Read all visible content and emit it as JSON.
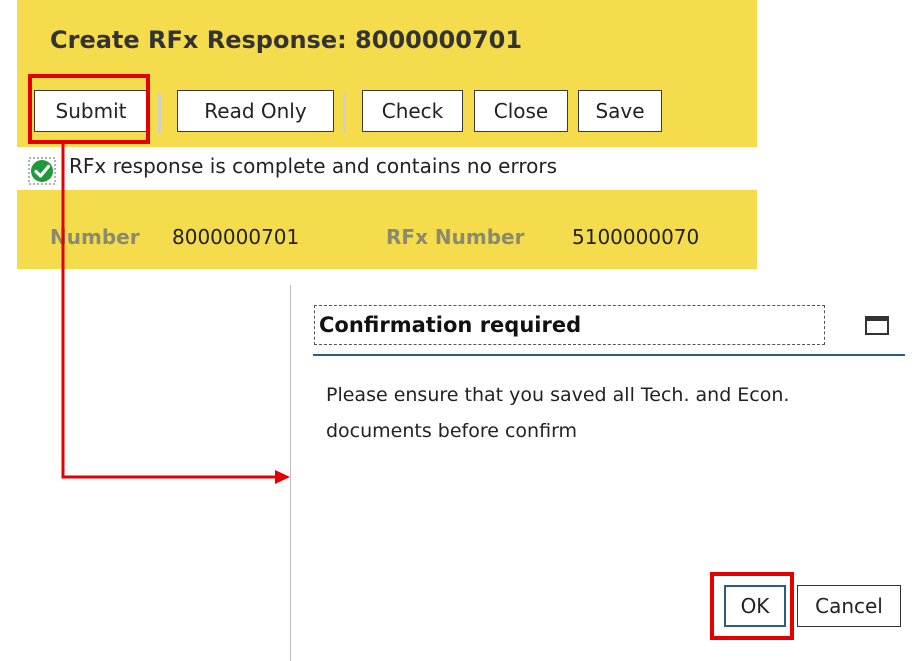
{
  "window": {
    "title": "Create RFx Response: 8000000701"
  },
  "toolbar": {
    "submit_label": "Submit",
    "read_only_label": "Read Only",
    "check_label": "Check",
    "close_label": "Close",
    "save_label": "Save"
  },
  "status": {
    "message": "RFx response  is complete and contains no errors",
    "icon": "check-circle-icon",
    "icon_color": "#1f9a3a"
  },
  "header_fields": {
    "number_label": "Number",
    "number_value": "8000000701",
    "rfx_number_label": "RFx Number",
    "rfx_number_value": "5100000070"
  },
  "dialog": {
    "title": "Confirmation required",
    "message": "Please ensure that you saved all Tech. and Econ. documents before confirm",
    "ok_label": "OK",
    "cancel_label": "Cancel"
  },
  "colors": {
    "band_yellow": "#f4dc4d",
    "highlight_red": "#e50000",
    "dialog_rule_blue": "#2a5d86"
  }
}
